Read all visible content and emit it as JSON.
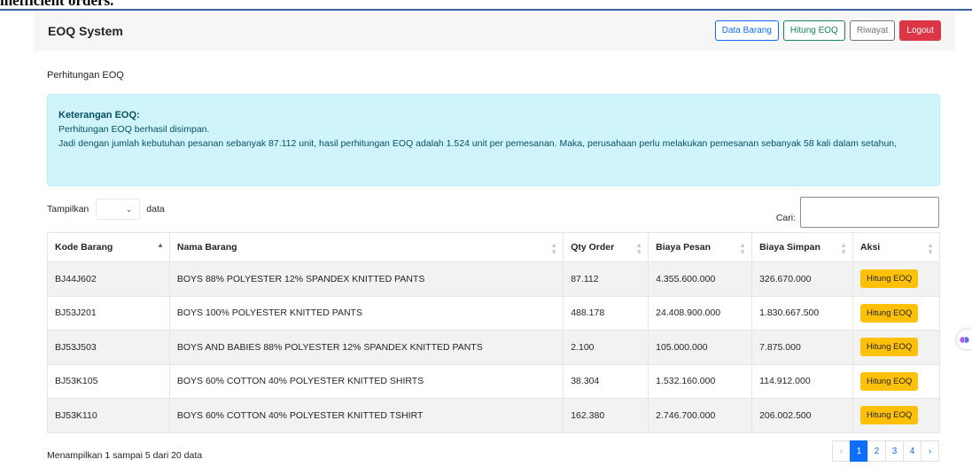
{
  "top_strip_text": "inefficient orders.",
  "navbar": {
    "brand": "EOQ System",
    "buttons": {
      "data_barang": "Data Barang",
      "hitung_eoq": "Hitung EOQ",
      "riwayat": "Riwayat",
      "logout": "Logout"
    }
  },
  "card_title": "Perhitungan EOQ",
  "alert": {
    "heading": "Keterangan EOQ:",
    "line1": "Perhitungan EOQ berhasil disimpan.",
    "line2": "Jadi dengan jumlah kebutuhan pesanan sebanyak 87.112 unit, hasil perhitungan EOQ adalah 1.524 unit per pemesanan. Maka, perusahaan perlu melakukan pemesanan sebanyak 58 kali dalam setahun,"
  },
  "controls": {
    "show_label": "Tampilkan",
    "show_suffix": "data",
    "search_label": "Cari:"
  },
  "table": {
    "headers": {
      "kode": "Kode Barang",
      "nama": "Nama Barang",
      "qty": "Qty Order",
      "pesan": "Biaya Pesan",
      "simpan": "Biaya Simpan",
      "aksi": "Aksi"
    },
    "action_label": "Hitung EOQ",
    "rows": [
      {
        "kode": "BJ44J602",
        "nama": "BOYS 88% POLYESTER 12% SPANDEX KNITTED PANTS",
        "qty": "87.112",
        "pesan": "4.355.600.000",
        "simpan": "326.670.000"
      },
      {
        "kode": "BJ53J201",
        "nama": "BOYS 100% POLYESTER KNITTED PANTS",
        "qty": "488.178",
        "pesan": "24.408.900.000",
        "simpan": "1.830.667.500"
      },
      {
        "kode": "BJ53J503",
        "nama": "BOYS AND BABIES 88% POLYESTER 12% SPANDEX KNITTED PANTS",
        "qty": "2.100",
        "pesan": "105.000.000",
        "simpan": "7.875.000"
      },
      {
        "kode": "BJ53K105",
        "nama": "BOYS 60% COTTON 40% POLYESTER KNITTED SHIRTS",
        "qty": "38.304",
        "pesan": "1.532.160.000",
        "simpan": "114.912.000"
      },
      {
        "kode": "BJ53K110",
        "nama": "BOYS 60% COTTON 40% POLYESTER KNITTED TSHIRT",
        "qty": "162.380",
        "pesan": "2.746.700.000",
        "simpan": "206.002.500"
      }
    ]
  },
  "footer": {
    "info": "Menampilkan 1 sampai 5 dari 20 data",
    "prev": "‹",
    "pages": [
      "1",
      "2",
      "3",
      "4"
    ],
    "next": "›"
  },
  "colors": {
    "primary": "#0d6efd",
    "success": "#198754",
    "secondary": "#6c757d",
    "danger": "#dc3545",
    "warning": "#ffc107",
    "alert_bg": "#cff4fc"
  }
}
